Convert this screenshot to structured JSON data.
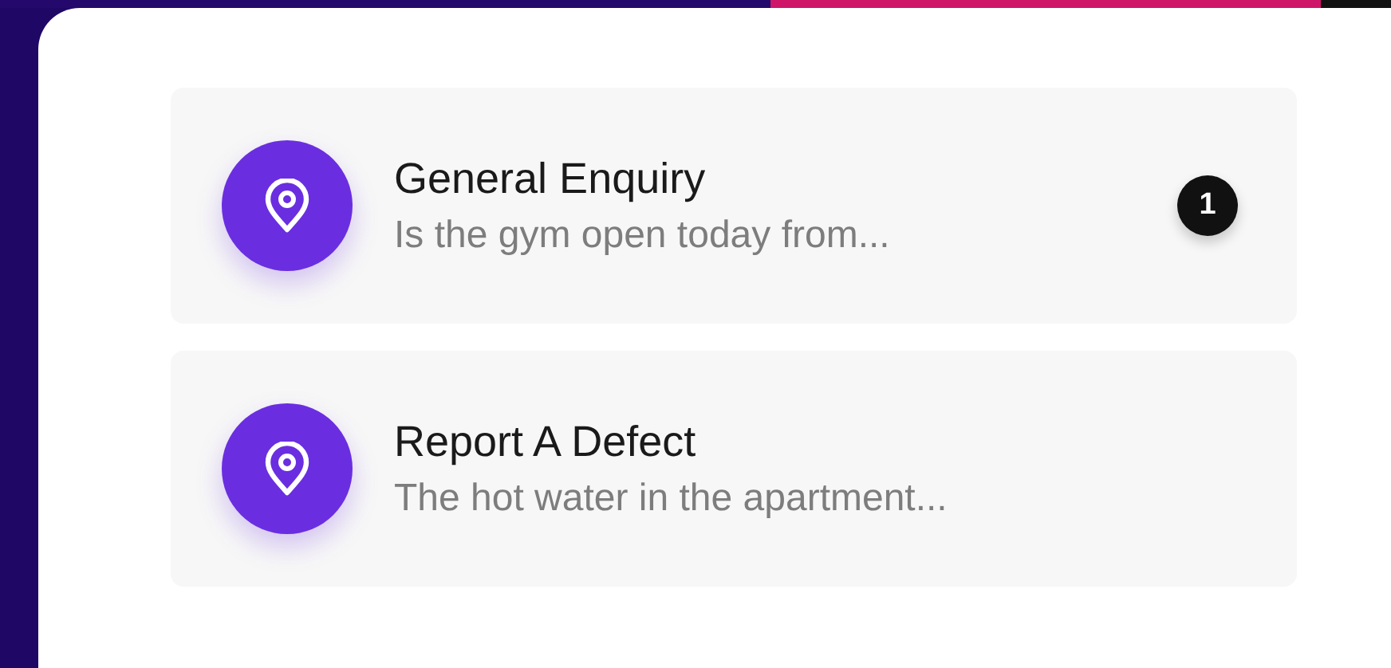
{
  "conversations": [
    {
      "title": "General Enquiry",
      "preview": "Is the gym open today from...",
      "badge": "1"
    },
    {
      "title": "Report A Defect",
      "preview": "The hot water in the apartment..."
    }
  ]
}
